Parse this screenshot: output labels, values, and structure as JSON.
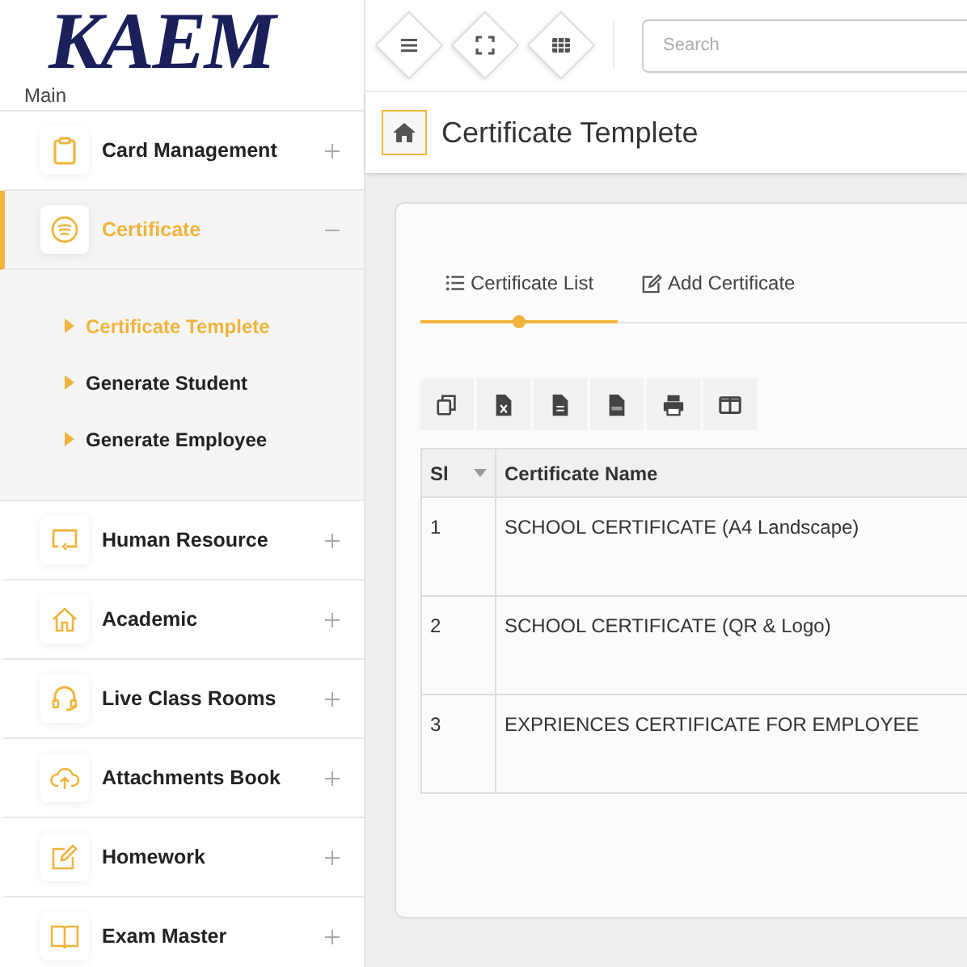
{
  "logo": "KAEM",
  "sidebar": {
    "heading": "Main",
    "items": [
      {
        "label": "Card Management",
        "expanded": false,
        "selected": false
      },
      {
        "label": "Certificate",
        "expanded": true,
        "selected": true,
        "children": [
          {
            "label": "Certificate Templete",
            "selected": true
          },
          {
            "label": "Generate Student",
            "selected": false
          },
          {
            "label": "Generate Employee",
            "selected": false
          }
        ]
      },
      {
        "label": "Human Resource",
        "expanded": false,
        "selected": false
      },
      {
        "label": "Academic",
        "expanded": false,
        "selected": false
      },
      {
        "label": "Live Class Rooms",
        "expanded": false,
        "selected": false
      },
      {
        "label": "Attachments Book",
        "expanded": false,
        "selected": false
      },
      {
        "label": "Homework",
        "expanded": false,
        "selected": false
      },
      {
        "label": "Exam Master",
        "expanded": false,
        "selected": false
      }
    ]
  },
  "search": {
    "placeholder": "Search"
  },
  "page_title": "Certificate Templete",
  "tabs": [
    {
      "label": "Certificate List",
      "selected": true
    },
    {
      "label": "Add Certificate",
      "selected": false
    }
  ],
  "table": {
    "columns": [
      "Sl",
      "Certificate Name"
    ],
    "rows": [
      [
        "1",
        "SCHOOL CERTIFICATE (A4 Landscape)"
      ],
      [
        "2",
        "SCHOOL CERTIFICATE (QR & Logo)"
      ],
      [
        "3",
        "EXPRIENCES CERTIFICATE FOR EMPLOYEE"
      ]
    ]
  }
}
